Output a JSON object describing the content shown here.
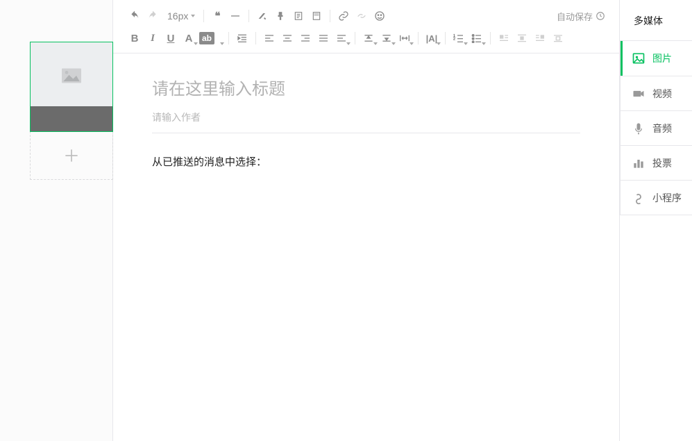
{
  "toolbar": {
    "font_size": "16px",
    "autosave": "自动保存"
  },
  "editor": {
    "title_placeholder": "请在这里输入标题",
    "author_placeholder": "请输入作者",
    "body_text": "从已推送的消息中选择："
  },
  "sidebar": {
    "title": "多媒体",
    "items": [
      {
        "label": "图片"
      },
      {
        "label": "视频"
      },
      {
        "label": "音频"
      },
      {
        "label": "投票"
      },
      {
        "label": "小程序"
      }
    ]
  }
}
